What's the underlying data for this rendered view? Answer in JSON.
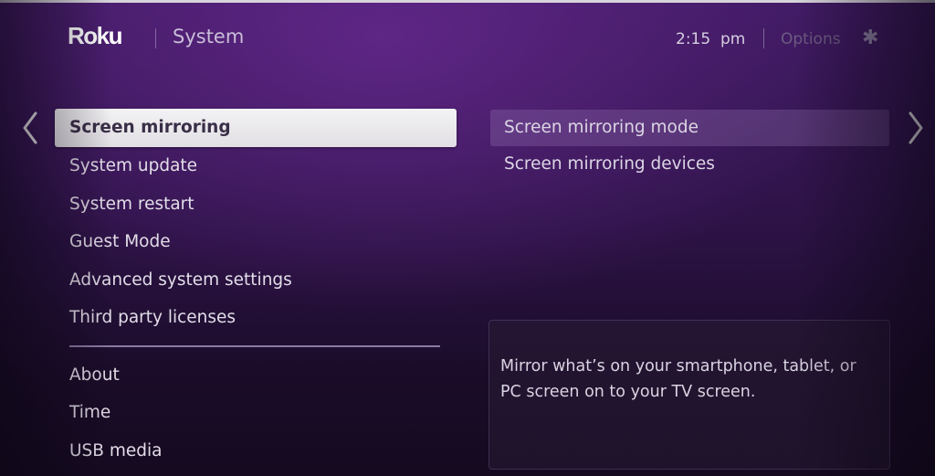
{
  "header": {
    "brand": "Roku",
    "title": "System",
    "time": "2:15  pm",
    "options_label": "Options",
    "options_icon": "asterisk-icon"
  },
  "navigation": {
    "back_icon": "chevron-left-icon",
    "forward_icon": "chevron-right-icon"
  },
  "left_menu": {
    "selected_index": 0,
    "items": [
      {
        "label": "Screen mirroring"
      },
      {
        "label": "System update"
      },
      {
        "label": "System restart"
      },
      {
        "label": "Guest Mode"
      },
      {
        "label": "Advanced system settings"
      },
      {
        "label": "Third party licenses"
      }
    ],
    "secondary_items": [
      {
        "label": "About"
      },
      {
        "label": "Time"
      },
      {
        "label": "USB media"
      }
    ]
  },
  "right_menu": {
    "focused_index": 0,
    "items": [
      {
        "label": "Screen mirroring mode"
      },
      {
        "label": "Screen mirroring devices"
      }
    ]
  },
  "description": {
    "text": "Mirror what’s on your smartphone, tablet, or PC screen on to your TV screen."
  },
  "colors": {
    "background_top": "#3f1a62",
    "background_bottom": "#150a20",
    "selected_item_bg": "#f3f2f4",
    "selected_item_text": "#3a2f48",
    "divider": "#8b7aa3"
  }
}
